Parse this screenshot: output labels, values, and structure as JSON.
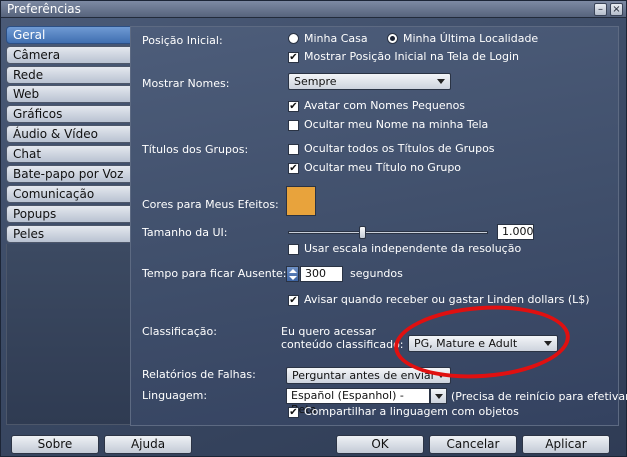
{
  "window": {
    "title": "Preferências"
  },
  "titlebar_buttons": {
    "minimize": "–",
    "close": "×"
  },
  "sidebar": {
    "tabs": [
      {
        "label": "Geral",
        "active": true
      },
      {
        "label": "Câmera"
      },
      {
        "label": "Rede"
      },
      {
        "label": "Web"
      },
      {
        "label": "Gráficos"
      },
      {
        "label": "Áudio & Vídeo"
      },
      {
        "label": "Chat"
      },
      {
        "label": "Bate-papo por Voz"
      },
      {
        "label": "Comunicação"
      },
      {
        "label": "Popups"
      },
      {
        "label": "Peles"
      }
    ]
  },
  "general": {
    "posicao_inicial_label": "Posição Inicial:",
    "radio_casa": "Minha Casa",
    "radio_ultima": "Minha Última Localidade",
    "radio_selected": "ultima",
    "mostrar_posicao": "Mostrar Posição Inicial na Tela de Login",
    "mostrar_nomes_label": "Mostrar Nomes:",
    "mostrar_nomes_value": "Sempre",
    "avatar_nomes_pequenos": "Avatar com Nomes Pequenos",
    "ocultar_nome": "Ocultar meu Nome na minha Tela",
    "titulos_grupos_label": "Títulos dos Grupos:",
    "ocultar_todos_titulos": "Ocultar todos os Títulos de Grupos",
    "ocultar_meu_titulo": "Ocultar meu Título no Grupo",
    "cores_efeitos_label": "Cores para Meus Efeitos:",
    "effect_color": "#e8a33c",
    "tamanho_ui_label": "Tamanho da UI:",
    "ui_scale_value": "1.000",
    "ui_scale_fraction": 0.37,
    "escala_independente": "Usar escala independente da resolução",
    "tempo_ausente_label": "Tempo para ficar Ausente:",
    "tempo_ausente_value": "300",
    "tempo_ausente_unit": "segundos",
    "avisar_linden": "Avisar quando receber ou gastar Linden dollars (L$)",
    "classificacao_label": "Classificação:",
    "classificacao_text_1": "Eu quero acessar",
    "classificacao_text_2": "conteúdo classificado:",
    "classificacao_value": "PG, Mature e Adult",
    "relatorios_label": "Relatórios de Falhas:",
    "relatorios_value": "Perguntar antes de enviar",
    "linguagem_label": "Linguagem:",
    "linguagem_value": "Español (Espanhol) - Beta",
    "linguagem_note": "(Precisa de reinício para efetivar)",
    "compartilhar_linguagem": "Compartilhar a linguagem com objetos"
  },
  "checkbox_states": {
    "mostrar_posicao": true,
    "avatar_nomes_pequenos": true,
    "ocultar_nome": false,
    "ocultar_todos_titulos": false,
    "ocultar_meu_titulo": true,
    "escala_independente": false,
    "avisar_linden": true,
    "compartilhar_linguagem": true
  },
  "footer": {
    "sobre": "Sobre",
    "ajuda": "Ajuda",
    "ok": "OK",
    "cancelar": "Cancelar",
    "aplicar": "Aplicar"
  },
  "check_glyph": "✔",
  "annotation_color": "#e01010"
}
